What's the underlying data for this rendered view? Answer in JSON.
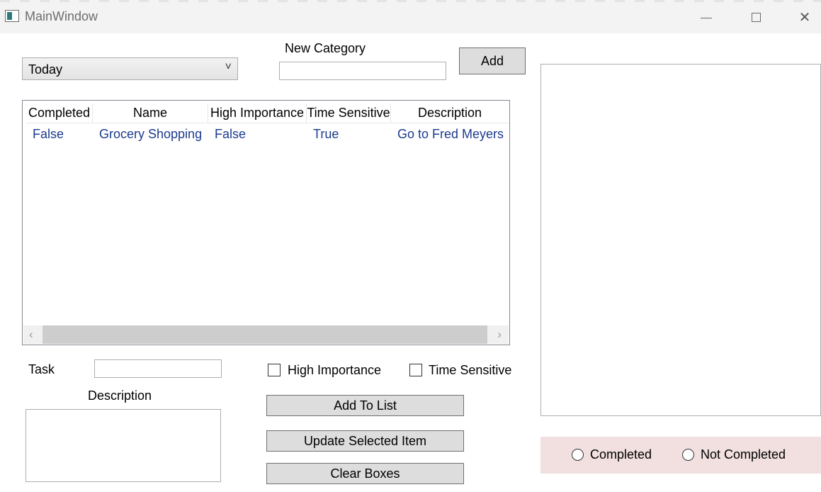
{
  "window": {
    "title": "MainWindow",
    "controls": [
      "minimize-icon",
      "maximize-icon",
      "close-icon"
    ],
    "close_glyph": "✕"
  },
  "category": {
    "selected": "Today",
    "arrow_glyph": "˅",
    "new_label": "New Category",
    "new_value": "",
    "add_label": "Add"
  },
  "tasks_list": {
    "columns": [
      "Completed",
      "Name",
      "High Importance",
      "Time Sensitive",
      "Description"
    ],
    "rows": [
      [
        "False",
        "Grocery Shopping",
        "False",
        "True",
        "Go to Fred Meyers"
      ]
    ],
    "scroll_left": "‹",
    "scroll_right": "›"
  },
  "form": {
    "task_label": "Task",
    "task_value": "",
    "description_label": "Description",
    "description_value": "",
    "high_importance_label": "High Importance",
    "high_importance_checked": false,
    "time_sensitive_label": "Time Sensitive",
    "time_sensitive_checked": false,
    "add_to_list_label": "Add To List",
    "update_label": "Update Selected Item",
    "clear_label": "Clear Boxes"
  },
  "status": {
    "completed_label": "Completed",
    "not_completed_label": "Not Completed"
  },
  "colors": {
    "cell_text": "#1c3b8e",
    "status_panel_bg": "#f2e0e0",
    "button_bg": "#dddddd"
  }
}
